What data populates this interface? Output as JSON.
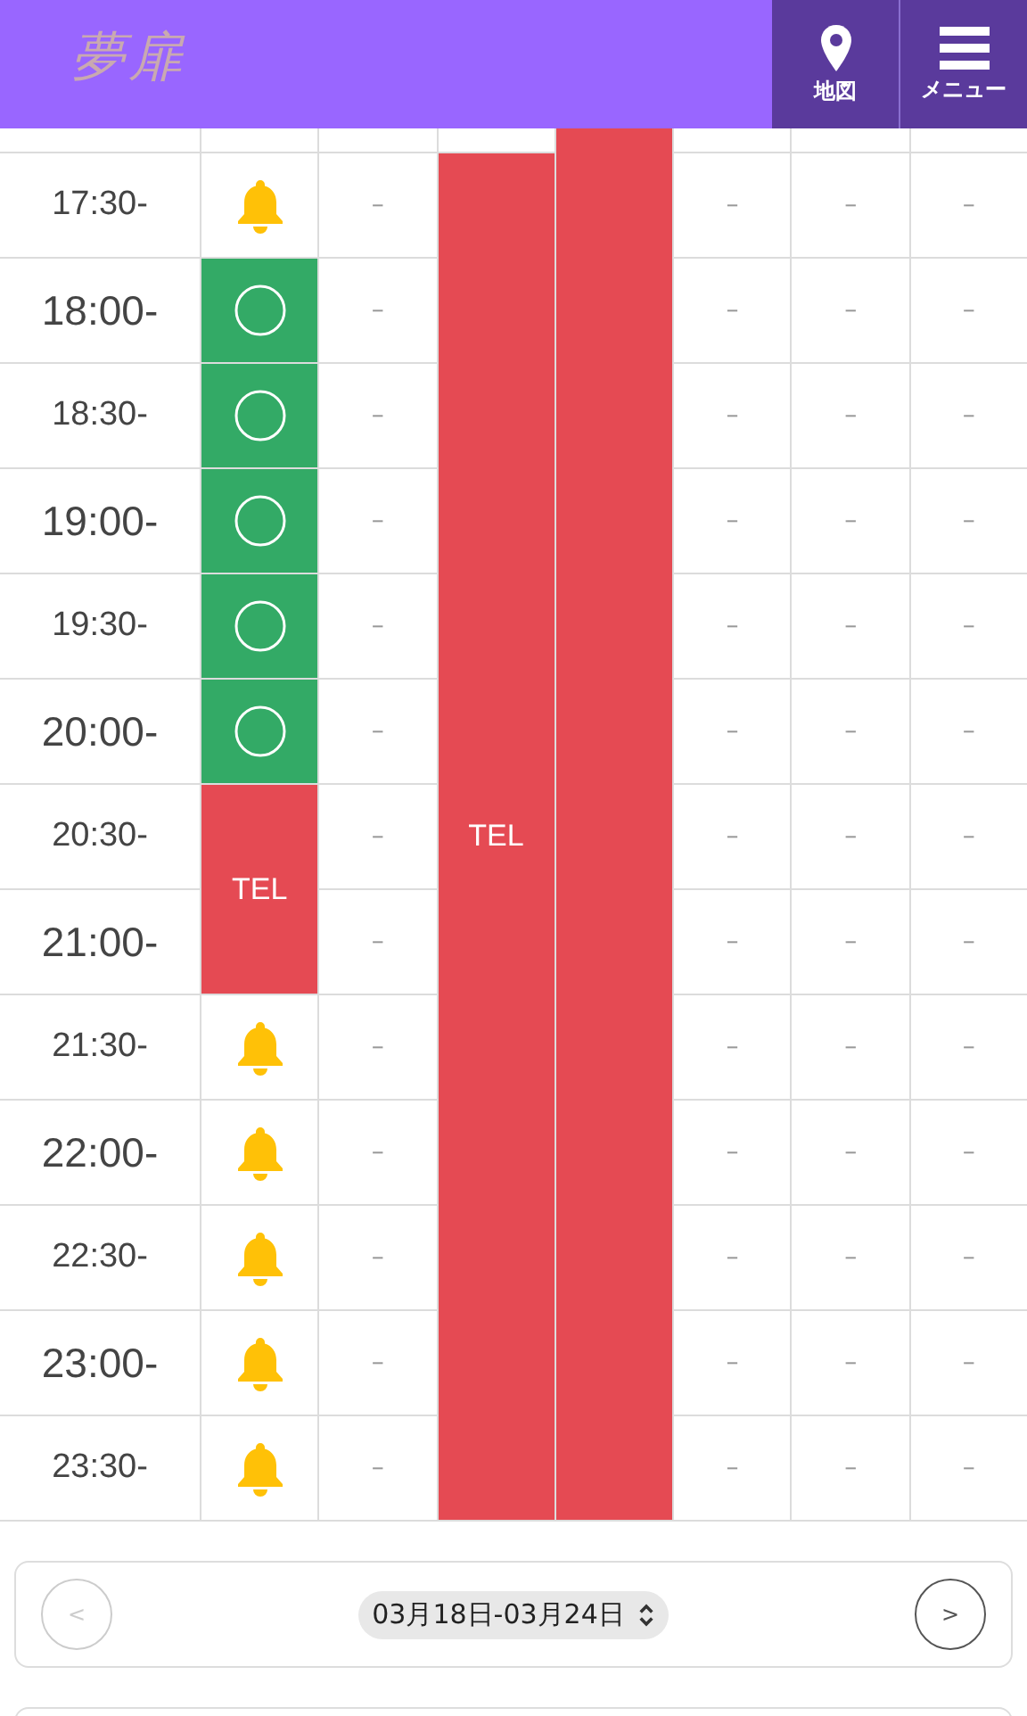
{
  "header": {
    "logo": "夢扉",
    "buttons": [
      {
        "kind": "map",
        "label": "地図"
      },
      {
        "kind": "menu",
        "label": "メニュー"
      }
    ]
  },
  "schedule": {
    "times": [
      {
        "kind": "partial"
      },
      {
        "time": "17:30-",
        "kind": "half"
      },
      {
        "time": "18:00-",
        "kind": "hour"
      },
      {
        "time": "18:30-",
        "kind": "half"
      },
      {
        "time": "19:00-",
        "kind": "hour"
      },
      {
        "time": "19:30-",
        "kind": "half"
      },
      {
        "time": "20:00-",
        "kind": "hour"
      },
      {
        "time": "20:30-",
        "kind": "half"
      },
      {
        "time": "21:00-",
        "kind": "hour"
      },
      {
        "time": "21:30-",
        "kind": "half"
      },
      {
        "time": "22:00-",
        "kind": "hour"
      },
      {
        "time": "22:30-",
        "kind": "half"
      },
      {
        "time": "23:00-",
        "kind": "hour"
      },
      {
        "time": "23:30-",
        "kind": "half"
      }
    ],
    "days": [
      {
        "cells": [
          {
            "kind": "blank"
          },
          {
            "kind": "bell"
          },
          {
            "kind": "open"
          },
          {
            "kind": "open"
          },
          {
            "kind": "open"
          },
          {
            "kind": "open"
          },
          {
            "kind": "open"
          },
          {
            "kind": "tel",
            "text": "TEL"
          },
          {
            "kind": "tel"
          },
          {
            "kind": "bell"
          },
          {
            "kind": "bell"
          },
          {
            "kind": "bell"
          },
          {
            "kind": "bell"
          },
          {
            "kind": "bell"
          }
        ]
      },
      {
        "cells": [
          {
            "kind": "blank"
          },
          {
            "kind": "none",
            "text": "–"
          },
          {
            "kind": "none",
            "text": "–"
          },
          {
            "kind": "none",
            "text": "–"
          },
          {
            "kind": "none",
            "text": "–"
          },
          {
            "kind": "none",
            "text": "–"
          },
          {
            "kind": "none",
            "text": "–"
          },
          {
            "kind": "none",
            "text": "–"
          },
          {
            "kind": "none",
            "text": "–"
          },
          {
            "kind": "none",
            "text": "–"
          },
          {
            "kind": "none",
            "text": "–"
          },
          {
            "kind": "none",
            "text": "–"
          },
          {
            "kind": "none",
            "text": "–"
          },
          {
            "kind": "none",
            "text": "–"
          }
        ]
      },
      {
        "cells": [
          {
            "kind": "blank"
          },
          {
            "kind": "tel",
            "text": "TEL"
          },
          {
            "kind": "tel"
          },
          {
            "kind": "tel"
          },
          {
            "kind": "tel"
          },
          {
            "kind": "tel"
          },
          {
            "kind": "tel"
          },
          {
            "kind": "tel"
          },
          {
            "kind": "tel"
          },
          {
            "kind": "tel"
          },
          {
            "kind": "tel"
          },
          {
            "kind": "tel"
          },
          {
            "kind": "tel"
          },
          {
            "kind": "tel"
          }
        ]
      },
      {
        "cells": [
          {
            "kind": "tel"
          },
          {
            "kind": "tel"
          },
          {
            "kind": "tel"
          },
          {
            "kind": "tel"
          },
          {
            "kind": "tel"
          },
          {
            "kind": "tel"
          },
          {
            "kind": "tel"
          },
          {
            "kind": "tel"
          },
          {
            "kind": "tel"
          },
          {
            "kind": "tel"
          },
          {
            "kind": "tel"
          },
          {
            "kind": "tel"
          },
          {
            "kind": "tel"
          },
          {
            "kind": "tel"
          }
        ]
      },
      {
        "cells": [
          {
            "kind": "blank"
          },
          {
            "kind": "none",
            "text": "–"
          },
          {
            "kind": "none",
            "text": "–"
          },
          {
            "kind": "none",
            "text": "–"
          },
          {
            "kind": "none",
            "text": "–"
          },
          {
            "kind": "none",
            "text": "–"
          },
          {
            "kind": "none",
            "text": "–"
          },
          {
            "kind": "none",
            "text": "–"
          },
          {
            "kind": "none",
            "text": "–"
          },
          {
            "kind": "none",
            "text": "–"
          },
          {
            "kind": "none",
            "text": "–"
          },
          {
            "kind": "none",
            "text": "–"
          },
          {
            "kind": "none",
            "text": "–"
          },
          {
            "kind": "none",
            "text": "–"
          }
        ]
      },
      {
        "cells": [
          {
            "kind": "blank"
          },
          {
            "kind": "none",
            "text": "–"
          },
          {
            "kind": "none",
            "text": "–"
          },
          {
            "kind": "none",
            "text": "–"
          },
          {
            "kind": "none",
            "text": "–"
          },
          {
            "kind": "none",
            "text": "–"
          },
          {
            "kind": "none",
            "text": "–"
          },
          {
            "kind": "none",
            "text": "–"
          },
          {
            "kind": "none",
            "text": "–"
          },
          {
            "kind": "none",
            "text": "–"
          },
          {
            "kind": "none",
            "text": "–"
          },
          {
            "kind": "none",
            "text": "–"
          },
          {
            "kind": "none",
            "text": "–"
          },
          {
            "kind": "none",
            "text": "–"
          }
        ]
      },
      {
        "cells": [
          {
            "kind": "blank"
          },
          {
            "kind": "none",
            "text": "–"
          },
          {
            "kind": "none",
            "text": "–"
          },
          {
            "kind": "none",
            "text": "–"
          },
          {
            "kind": "none",
            "text": "–"
          },
          {
            "kind": "none",
            "text": "–"
          },
          {
            "kind": "none",
            "text": "–"
          },
          {
            "kind": "none",
            "text": "–"
          },
          {
            "kind": "none",
            "text": "–"
          },
          {
            "kind": "none",
            "text": "–"
          },
          {
            "kind": "none",
            "text": "–"
          },
          {
            "kind": "none",
            "text": "–"
          },
          {
            "kind": "none",
            "text": "–"
          },
          {
            "kind": "none",
            "text": "–"
          }
        ]
      }
    ]
  },
  "week_nav": {
    "prev": {
      "label": "<",
      "disabled": true
    },
    "range": "03月18日-03月24日",
    "next": {
      "label": ">",
      "disabled": false
    }
  }
}
